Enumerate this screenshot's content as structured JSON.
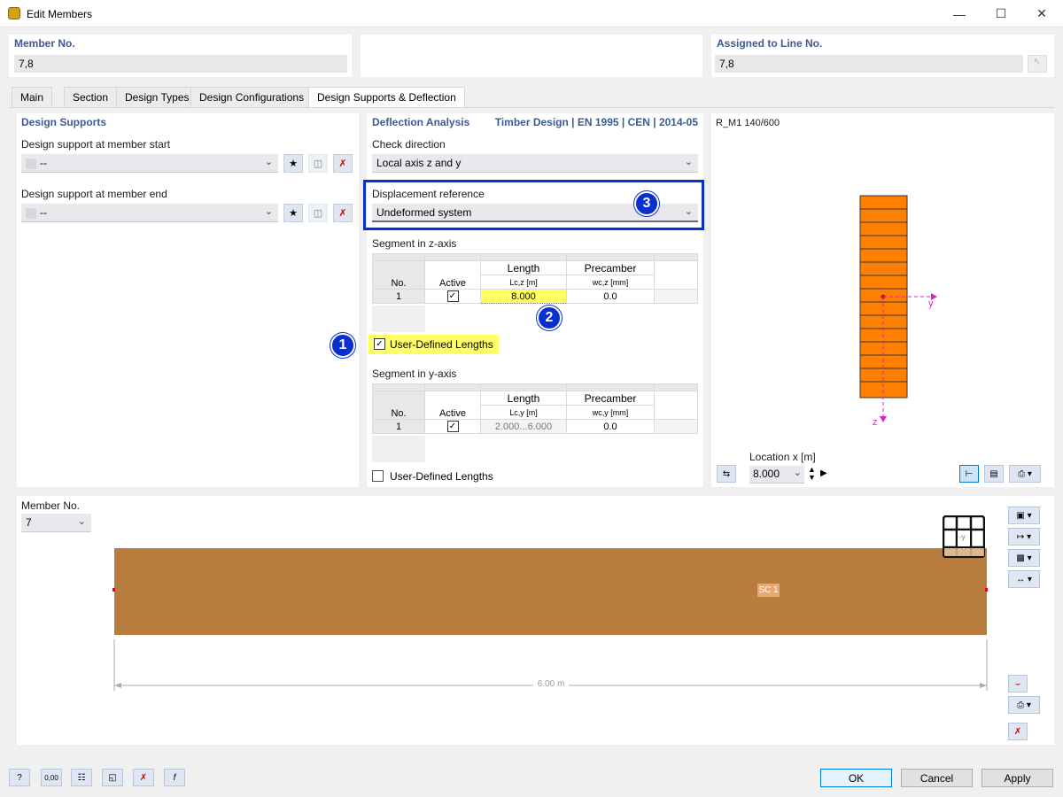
{
  "window": {
    "title": "Edit Members"
  },
  "header": {
    "member_no_label": "Member No.",
    "member_no_value": "7,8",
    "assigned_label": "Assigned to Line No.",
    "assigned_value": "7,8"
  },
  "tabs": [
    {
      "label": "Main"
    },
    {
      "label": "Section"
    },
    {
      "label": "Design Types"
    },
    {
      "label": "Design Configurations"
    },
    {
      "label": "Design Supports & Deflection",
      "active": true
    }
  ],
  "design_supports": {
    "title": "Design Supports",
    "start_label": "Design support at member start",
    "start_value": "--",
    "end_label": "Design support at member end",
    "end_value": "--"
  },
  "deflection": {
    "title": "Deflection Analysis",
    "standard": "Timber Design | EN 1995 | CEN | 2014-05",
    "check_direction_label": "Check direction",
    "check_direction_value": "Local axis z and y",
    "displacement_label": "Displacement reference",
    "displacement_value": "Undeformed system",
    "z_segment_label": "Segment in z-axis",
    "z_table": {
      "col_no": "No.",
      "col_active": "Active",
      "col_length": "Length",
      "col_length_sub": "Lc,z [m]",
      "col_precamber": "Precamber",
      "col_precamber_sub": "wc,z [mm]",
      "rows": [
        {
          "no": "1",
          "active": true,
          "length": "8.000",
          "precamber": "0.0"
        }
      ]
    },
    "z_user_defined_label": "User-Defined Lengths",
    "z_user_defined_checked": true,
    "y_segment_label": "Segment in y-axis",
    "y_table": {
      "col_no": "No.",
      "col_active": "Active",
      "col_length": "Length",
      "col_length_sub": "Lc,y [m]",
      "col_precamber": "Precamber",
      "col_precamber_sub": "wc,y [mm]",
      "rows": [
        {
          "no": "1",
          "active": true,
          "length": "2.000...6.000",
          "precamber": "0.0"
        }
      ]
    },
    "y_user_defined_label": "User-Defined Lengths",
    "y_user_defined_checked": false
  },
  "section_view": {
    "title": "R_M1 140/600",
    "axis_y": "y",
    "axis_z": "z",
    "location_label": "Location x [m]",
    "location_value": "8.000"
  },
  "member_view": {
    "member_no_label": "Member No.",
    "member_no_value": "7",
    "segment_label": "SC 1",
    "dimension_label": "6.00 m",
    "axis_label": "-y"
  },
  "badges": {
    "one": "1",
    "two": "2",
    "three": "3"
  },
  "footer": {
    "ok": "OK",
    "cancel": "Cancel",
    "apply": "Apply",
    "value_icon_text": "0,00"
  },
  "colors": {
    "accent_blue": "#0a2fcf",
    "section_orange": "#ff8000",
    "member_brown": "#b87c3e",
    "highlight_yellow": "#ffff66",
    "axis_magenta": "#e020c0"
  }
}
